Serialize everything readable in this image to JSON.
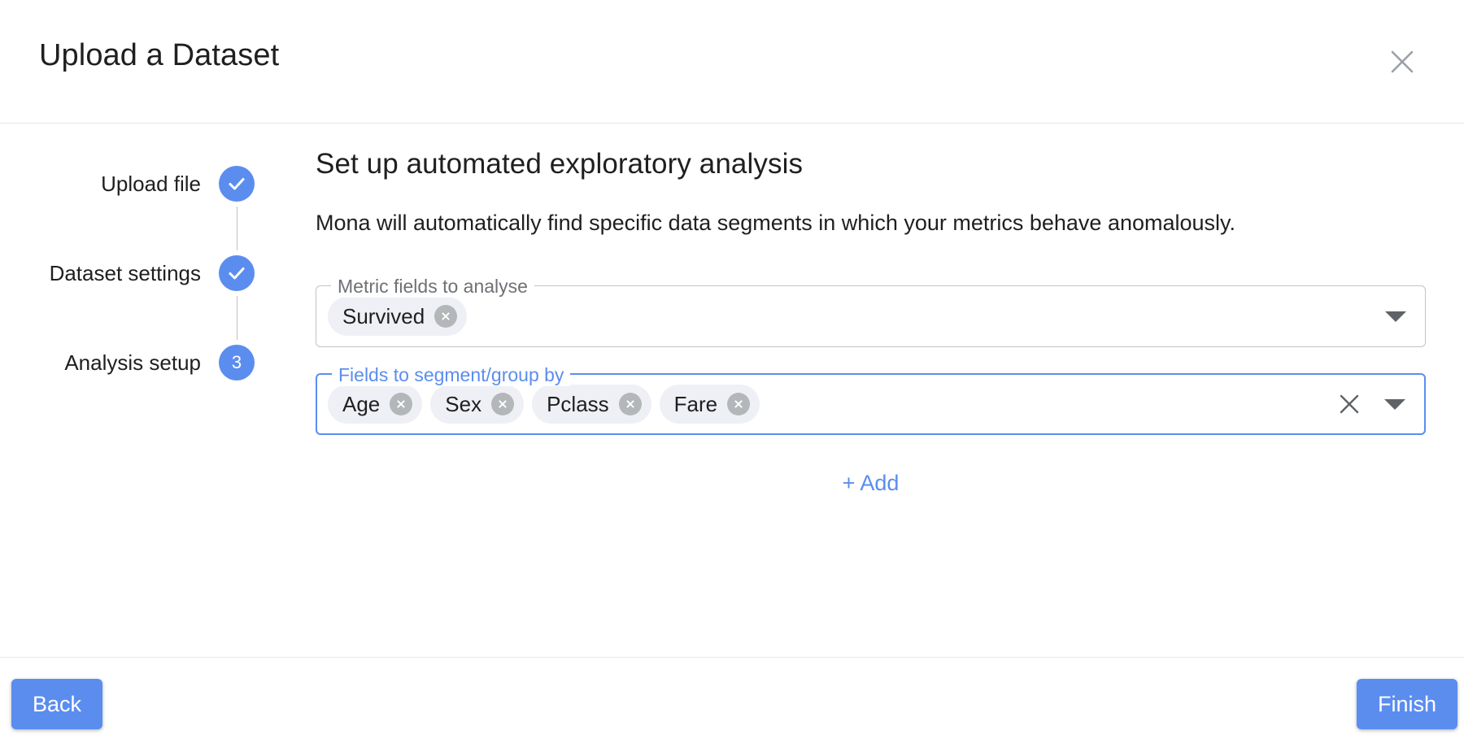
{
  "dialog": {
    "title": "Upload a Dataset",
    "close_icon": "close-icon"
  },
  "stepper": {
    "steps": [
      {
        "label": "Upload file",
        "state": "complete",
        "marker": "check-icon"
      },
      {
        "label": "Dataset settings",
        "state": "complete",
        "marker": "check-icon"
      },
      {
        "label": "Analysis setup",
        "state": "active",
        "marker": "3"
      }
    ]
  },
  "panel": {
    "heading": "Set up automated exploratory analysis",
    "description": "Mona will automatically find specific data segments in which your metrics behave anomalously."
  },
  "fields": [
    {
      "legend": "Metric fields to analyse",
      "focused": false,
      "chips": [
        "Survived"
      ],
      "has_clear": false,
      "dropdown_icon": "chevron-down-icon"
    },
    {
      "legend": "Fields to segment/group by",
      "focused": true,
      "chips": [
        "Age",
        "Sex",
        "Pclass",
        "Fare"
      ],
      "has_clear": true,
      "clear_icon": "clear-icon",
      "dropdown_icon": "chevron-down-icon"
    }
  ],
  "add_link": {
    "label": "+ Add"
  },
  "footer": {
    "back_label": "Back",
    "finish_label": "Finish"
  },
  "colors": {
    "accent": "#5b8def",
    "chip_bg": "#eff0f5",
    "chip_remove": "#b4b7ba",
    "border": "#c0c3c7",
    "text": "#1f1f1f",
    "muted": "#6e7175"
  }
}
